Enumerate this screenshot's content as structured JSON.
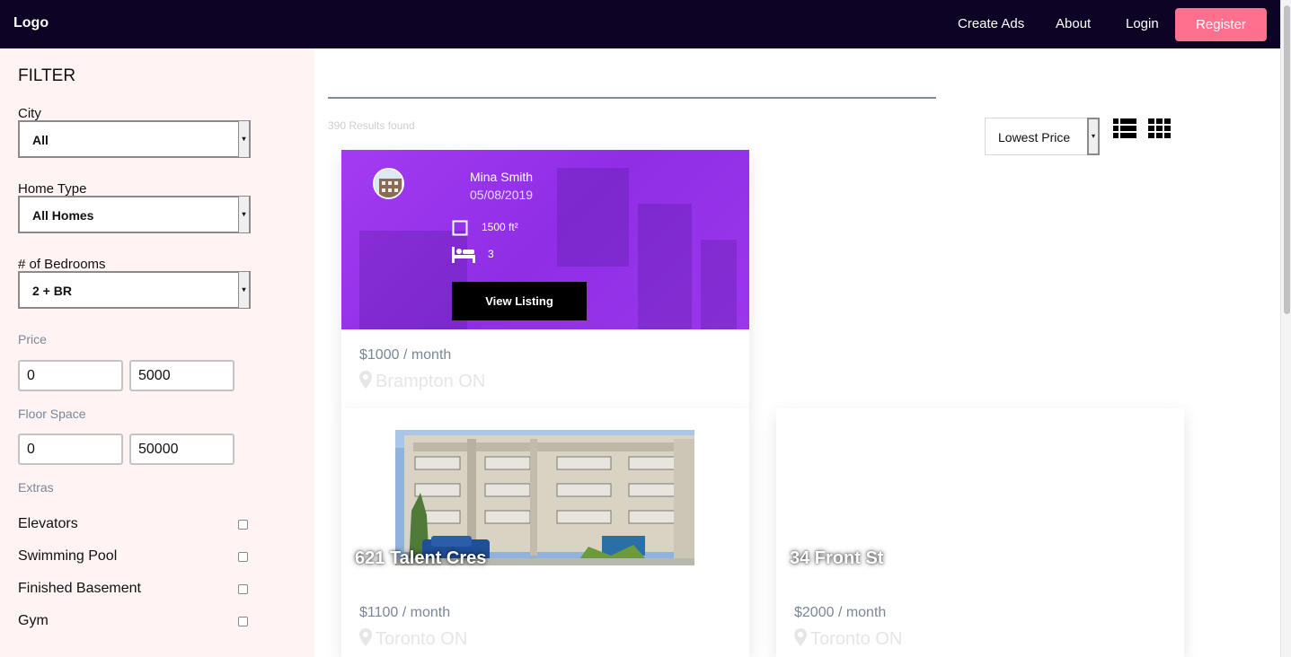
{
  "nav": {
    "logo": "Logo",
    "links": [
      "Create Ads",
      "About",
      "Login"
    ],
    "register": "Register",
    "accent": "#ff6f8e",
    "background": "#0d0325"
  },
  "filter": {
    "title": "FILTER",
    "city": {
      "label": "City",
      "value": "All"
    },
    "home_type": {
      "label": "Home Type",
      "value": "All Homes"
    },
    "bedrooms": {
      "label": "# of Bedrooms",
      "value": "2 + BR"
    },
    "price": {
      "label": "Price",
      "min": "0",
      "max": "5000"
    },
    "floor_space": {
      "label": "Floor Space",
      "min": "0",
      "max": "50000"
    },
    "extras": {
      "label": "Extras",
      "items": [
        "Elevators",
        "Swimming Pool",
        "Finished Basement",
        "Gym"
      ]
    }
  },
  "results": {
    "count_text": "390 Results found",
    "sort_value": "Lowest Price",
    "view_icons": [
      "list-view-icon",
      "grid-view-icon"
    ]
  },
  "listings": [
    {
      "owner": "Mina Smith",
      "date": "05/08/2019",
      "area": "1500 ft²",
      "bedrooms": "3",
      "button": "View Listing",
      "price": "$1000 / month",
      "location": "Brampton ON"
    },
    {
      "address": "621 Talent Cres",
      "price": "$1100 / month",
      "location": "Toronto ON"
    },
    {
      "address": "34 Front St",
      "price": "$2000 / month",
      "location": "Toronto ON"
    }
  ]
}
